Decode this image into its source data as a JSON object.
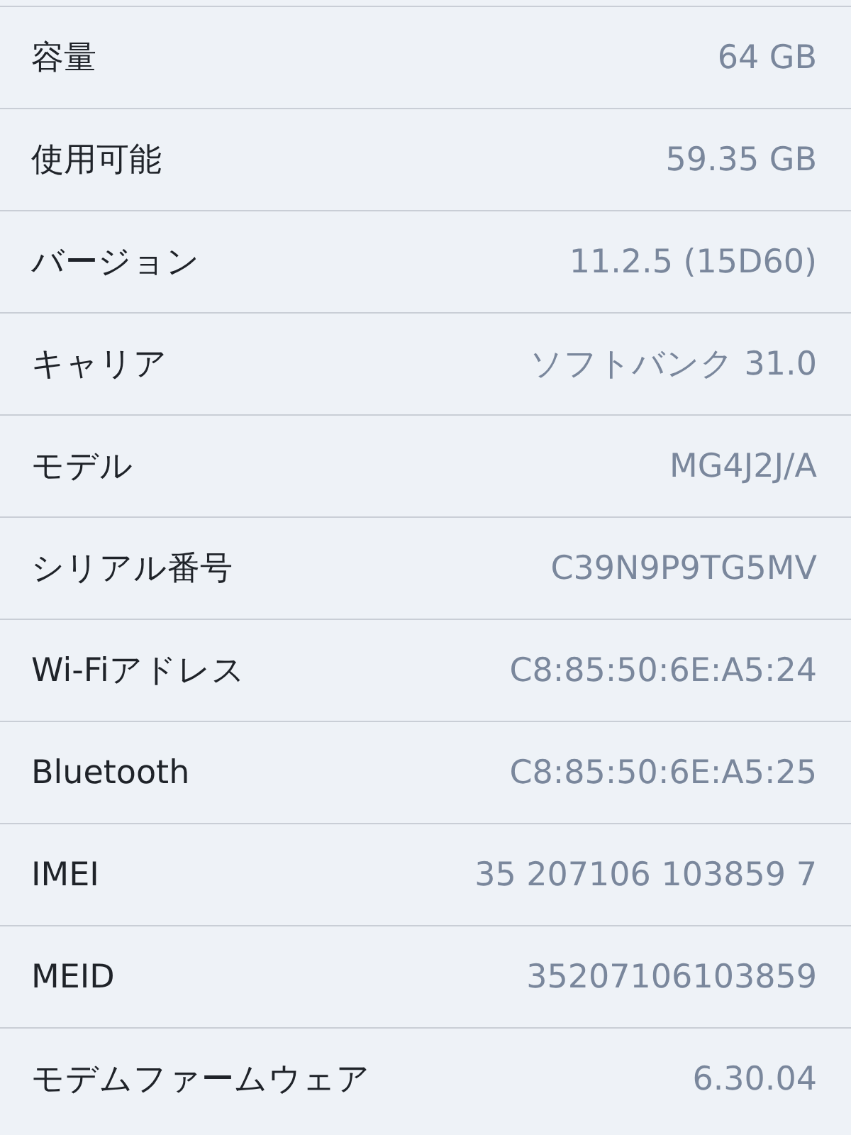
{
  "rows": [
    {
      "label": "容量",
      "value": "64 GB"
    },
    {
      "label": "使用可能",
      "value": "59.35 GB"
    },
    {
      "label": "バージョン",
      "value": "11.2.5 (15D60)"
    },
    {
      "label": "キャリア",
      "value": "ソフトバンク 31.0"
    },
    {
      "label": "モデル",
      "value": "MG4J2J/A"
    },
    {
      "label": "シリアル番号",
      "value": "C39N9P9TG5MV"
    },
    {
      "label": "Wi-Fiアドレス",
      "value": "C8:85:50:6E:A5:24"
    },
    {
      "label": "Bluetooth",
      "value": "C8:85:50:6E:A5:25"
    },
    {
      "label": "IMEI",
      "value": "35 207106 103859 7"
    },
    {
      "label": "MEID",
      "value": "35207106103859"
    },
    {
      "label": "モデムファームウェア",
      "value": "6.30.04"
    }
  ]
}
